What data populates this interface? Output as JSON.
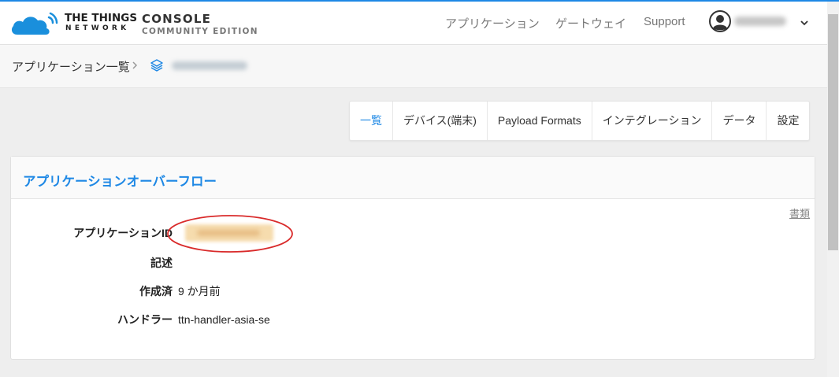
{
  "brand": {
    "name": "THE THINGS",
    "sub": "NETWORK",
    "console_title": "CONSOLE",
    "console_sub": "COMMUNITY EDITION"
  },
  "nav": {
    "applications": "アプリケーション",
    "gateways": "ゲートウェイ",
    "support": "Support"
  },
  "breadcrumb": {
    "applications": "アプリケーション一覧"
  },
  "tabs": [
    {
      "label": "一覧",
      "active": true
    },
    {
      "label": "デバイス(端末)",
      "active": false
    },
    {
      "label": "Payload Formats",
      "active": false
    },
    {
      "label": "インテグレーション",
      "active": false
    },
    {
      "label": "データ",
      "active": false
    },
    {
      "label": "設定",
      "active": false
    }
  ],
  "overview": {
    "title": "アプリケーションオーバーフロー",
    "docs_link": "書類",
    "labels": {
      "app_id": "アプリケーションID",
      "description": "記述",
      "created": "作成済",
      "handler": "ハンドラー"
    },
    "values": {
      "created": "9 か月前",
      "handler": "ttn-handler-asia-se"
    }
  },
  "colors": {
    "accent": "#1e88e5",
    "logo": "#1a8fdc",
    "highlight_ellipse": "#d92a2a"
  },
  "icons": {
    "logo": "cloud-wifi-icon",
    "avatar": "user-avatar-icon",
    "dropdown": "chevron-down-icon",
    "separator": "chevron-right-icon",
    "application": "layers-icon"
  }
}
